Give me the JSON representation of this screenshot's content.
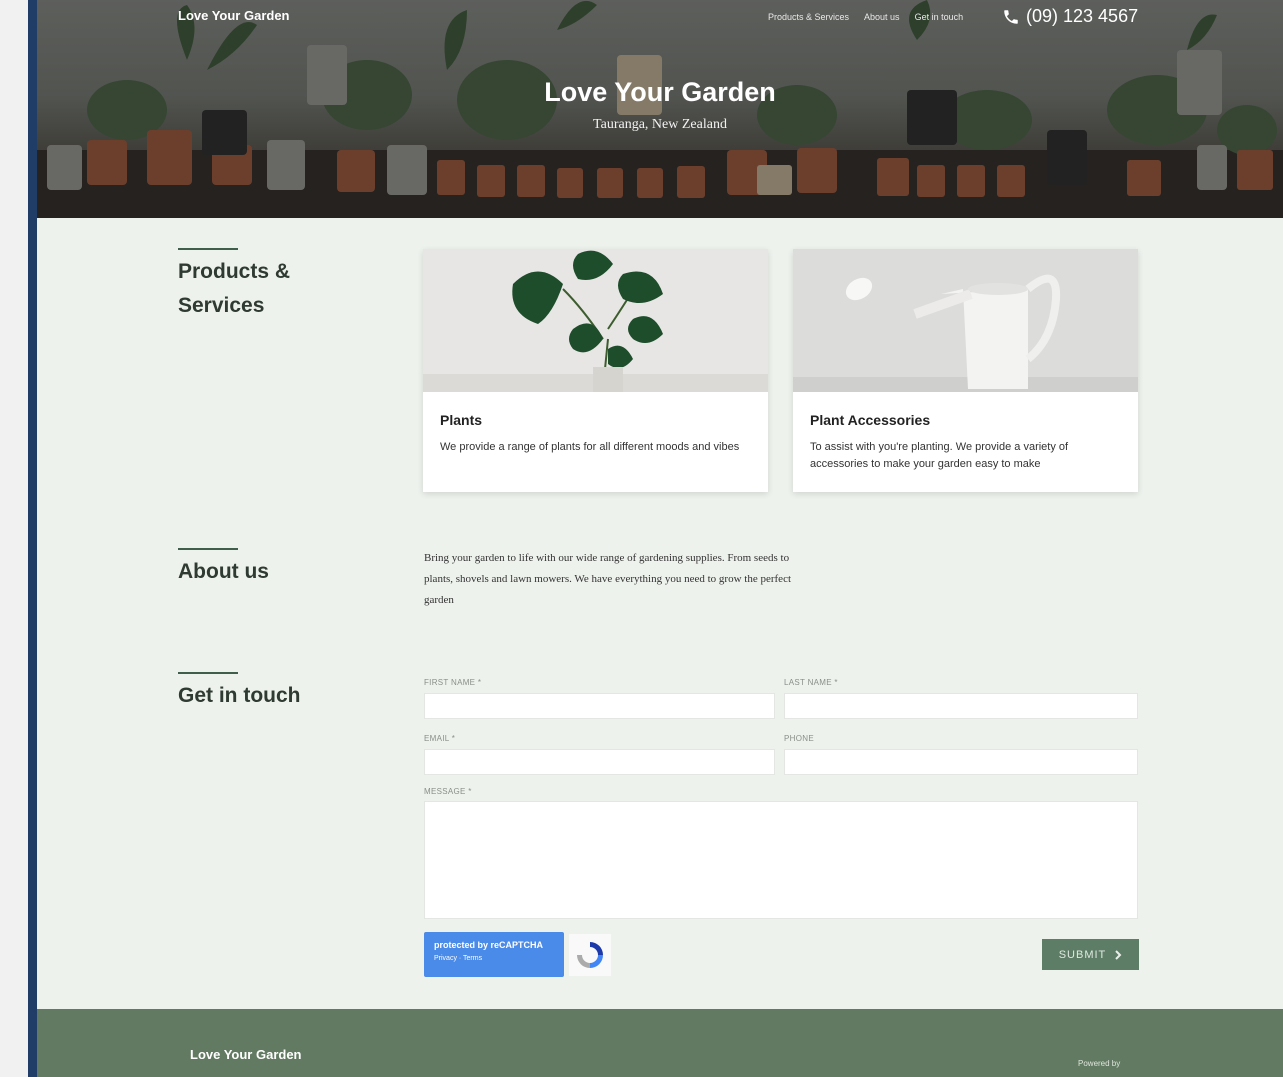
{
  "header": {
    "brand": "Love Your Garden",
    "nav": [
      {
        "label": "Products & Services"
      },
      {
        "label": "About us"
      },
      {
        "label": "Get in touch"
      }
    ],
    "phone": "(09) 123 4567"
  },
  "hero": {
    "title": "Love Your Garden",
    "subtitle": "Tauranga, New Zealand"
  },
  "products": {
    "title": "Products & Services",
    "cards": [
      {
        "title": "Plants",
        "description": "We provide a range of plants for all different moods and vibes"
      },
      {
        "title": "Plant Accessories",
        "description": "To assist with you're planting. We provide a variety of accessories to make your garden easy to make"
      }
    ]
  },
  "about": {
    "title": "About us",
    "text": "Bring your garden to life with our wide range of gardening supplies. From seeds to plants, shovels and lawn mowers. We have everything you need to grow the perfect garden"
  },
  "contact": {
    "title": "Get in touch",
    "first_name_label": "FIRST NAME *",
    "last_name_label": "LAST NAME *",
    "email_label": "EMAIL *",
    "phone_label": "PHONE",
    "message_label": "MESSAGE *",
    "captcha_line1": "protected by reCAPTCHA",
    "captcha_line2": "Privacy · Terms",
    "submit_label": "SUBMIT"
  },
  "footer": {
    "brand": "Love Your Garden",
    "powered": "Powered by"
  },
  "colors": {
    "accent": "#5e7d66",
    "footer": "#637a62",
    "page_bg": "#eef2ed",
    "frame": "#1f3d66"
  },
  "icons": [
    "phone-icon",
    "chevron-right-icon",
    "recaptcha-icon"
  ]
}
